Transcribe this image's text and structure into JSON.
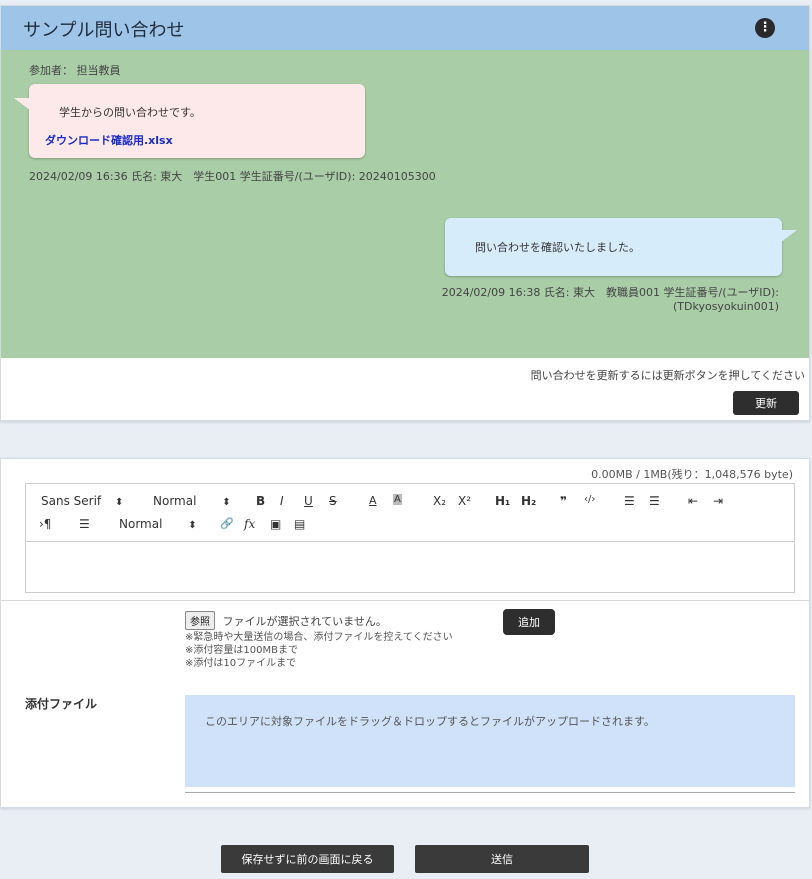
{
  "header": {
    "title": "サンプル問い合わせ",
    "menu_icon": "more-vertical-icon",
    "menu_glyph": "⋮"
  },
  "chat": {
    "participants": "参加者： 担当教員",
    "messages": [
      {
        "side": "left",
        "text": "学生からの問い合わせです。",
        "attachment": "ダウンロード確認用.xlsx",
        "meta": "2024/02/09 16:36 氏名: 東大　学生001 学生証番号/(ユーザID): 20240105300"
      },
      {
        "side": "right",
        "text": "問い合わせを確認いたしました。",
        "meta_line1": "2024/02/09 16:38 氏名: 東大　教職員001 学生証番号/(ユーザID):",
        "meta_line2": "(TDkyosyokuin001)"
      }
    ],
    "refresh_note": "問い合わせを更新するには更新ボタンを押してください",
    "refresh_label": "更新"
  },
  "form": {
    "size_info": "0.00MB / 1MB(残り：1,048,576 byte)",
    "toolbar": {
      "font": "Sans Serif",
      "size": "Normal",
      "bold": "B",
      "italic": "I",
      "underline": "U",
      "strike": "S",
      "color": "A",
      "background": "A",
      "subscript": "X₂",
      "superscript": "X²",
      "h1": "H₁",
      "h2": "H₂",
      "blockquote": "❞",
      "code": "‹/›",
      "ordered_list": "☰",
      "bullet_list": "☰",
      "outdent": "⇤",
      "indent": "⇥",
      "direction": "›¶",
      "align": "☰",
      "header_select": "Normal",
      "link": "🔗",
      "formula": "fx",
      "image": "▣",
      "video": "▤",
      "select_arrow": "⬍"
    },
    "browse_label": "参照",
    "no_file": "ファイルが選択されていません。",
    "add_label": "追加",
    "notes": [
      "※緊急時や大量送信の場合、添付ファイルを控えてください",
      "※添付容量は100MBまで",
      "※添付は10ファイルまで"
    ],
    "attach_label": "添付ファイル",
    "dropzone_text": "このエリアに対象ファイルをドラッグ＆ドロップするとファイルがアップロードされます。"
  },
  "footer": {
    "back_label": "保存せずに前の画面に戻る",
    "send_label": "送信"
  }
}
